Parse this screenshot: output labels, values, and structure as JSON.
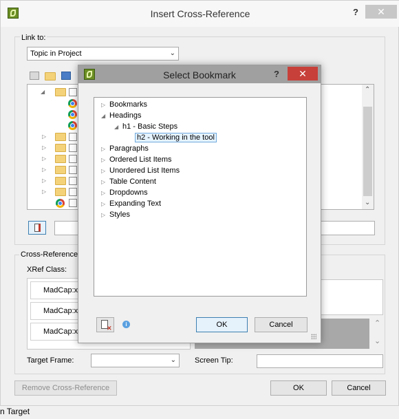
{
  "outer": {
    "title": "Insert Cross-Reference",
    "help": "?",
    "close": "✕",
    "link_to_label": "Link to:",
    "link_to_value": "Topic in Project",
    "cross_reference_label": "Cross-Reference",
    "xref_class_label": "XRef Class:",
    "xref_items": [
      "MadCap:x",
      "MadCap:x",
      "MadCap:x"
    ],
    "target_frame_label": "Target Frame:",
    "screen_tip_label": "Screen Tip:",
    "remove_button": "Remove Cross-Reference",
    "ok_button": "OK",
    "cancel_button": "Cancel",
    "status_text": "n Target"
  },
  "modal": {
    "title": "Select Bookmark",
    "help": "?",
    "close": "✕",
    "tree": [
      {
        "label": "Bookmarks",
        "indent": 0,
        "expander": "▷"
      },
      {
        "label": "Headings",
        "indent": 0,
        "expander": "◢"
      },
      {
        "label": "h1 - Basic Steps",
        "indent": 1,
        "expander": "◢"
      },
      {
        "label": "h2 - Working in the tool",
        "indent": 2,
        "expander": "",
        "selected": true
      },
      {
        "label": "Paragraphs",
        "indent": 0,
        "expander": "▷"
      },
      {
        "label": "Ordered List Items",
        "indent": 0,
        "expander": "▷"
      },
      {
        "label": "Unordered List Items",
        "indent": 0,
        "expander": "▷"
      },
      {
        "label": "Table Content",
        "indent": 0,
        "expander": "▷"
      },
      {
        "label": "Dropdowns",
        "indent": 0,
        "expander": "▷"
      },
      {
        "label": "Expanding Text",
        "indent": 0,
        "expander": "▷"
      },
      {
        "label": "Styles",
        "indent": 0,
        "expander": "▷"
      }
    ],
    "info": "i",
    "ok_button": "OK",
    "cancel_button": "Cancel"
  }
}
